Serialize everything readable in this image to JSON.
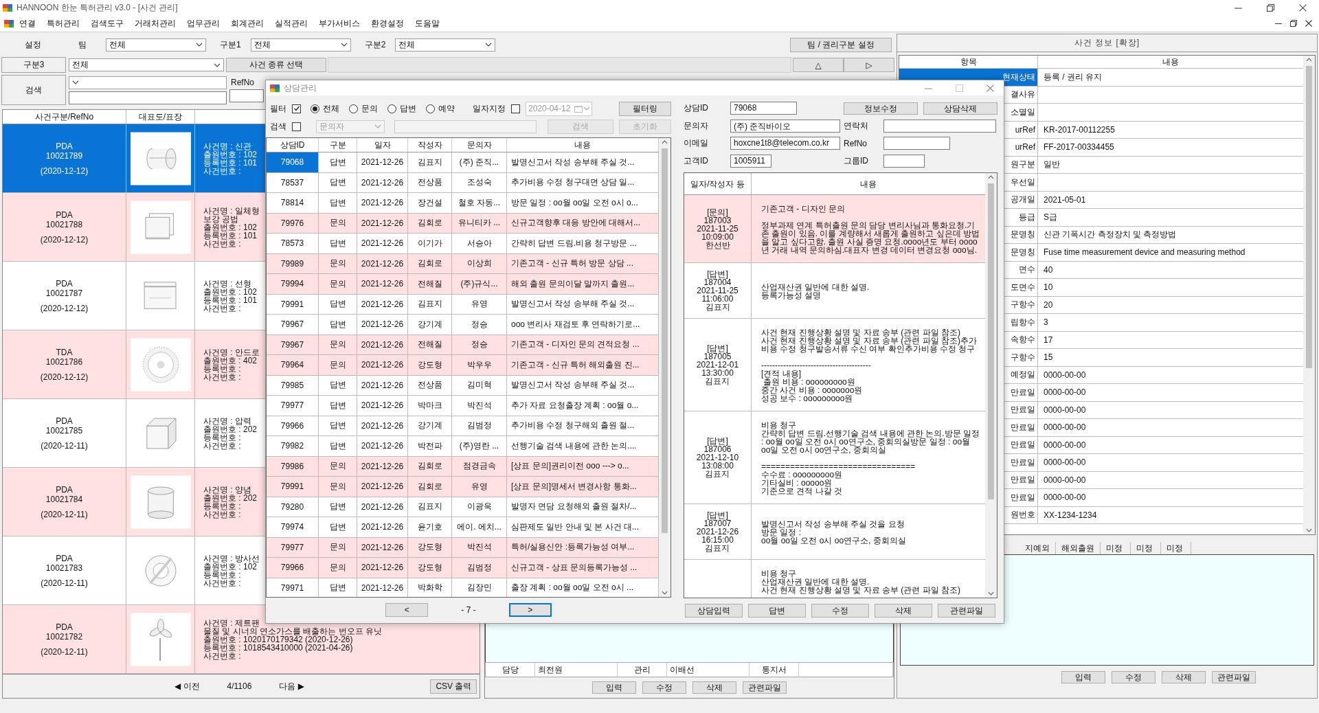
{
  "window": {
    "title": "HANNOON 한눈 특허관리 v3.0 - [사건 관리]"
  },
  "menu": [
    "연결",
    "특허관리",
    "검색도구",
    "거래처관리",
    "업무관리",
    "회계관리",
    "실적관리",
    "부가서비스",
    "환경설정",
    "도움말"
  ],
  "filters": {
    "setting_label": "설정",
    "team_label": "팀",
    "team": "전체",
    "group1_label": "구분1",
    "group1": "전체",
    "group2_label": "구분2",
    "group2": "전체",
    "team_button": "팀 / 권리구분 설정",
    "group3_label": "구분3",
    "group3": "전체",
    "type_button": "사건 종류 선택",
    "up_button": "△",
    "next_button": "▷",
    "search_label": "검색",
    "refno_label": "RefNo"
  },
  "case_list": {
    "columns": [
      "사건구분/RefNo",
      "대표도/표장"
    ],
    "rows": [
      {
        "type": "PDA",
        "ref": "10021789",
        "date": "(2020-12-12)",
        "details": [
          "사건명 : 신관",
          "출원번호 : 102",
          "등록번호 : 101",
          "사건번호 :"
        ],
        "selected": true,
        "highlighted": false
      },
      {
        "type": "PDA",
        "ref": "10021788",
        "date": "(2020-12-12)",
        "details": [
          "사건명 : 일체형",
          "보강 공법",
          "출원번호 : 102",
          "등록번호 : 101",
          "사건번호 :"
        ],
        "selected": false,
        "highlighted": true
      },
      {
        "type": "PDA",
        "ref": "10021787",
        "date": "(2020-12-12)",
        "details": [
          "사건명 : 선형",
          "출원번호 : 102",
          "등록번호 : 101",
          "사건번호 :"
        ],
        "selected": false,
        "highlighted": false
      },
      {
        "type": "TDA",
        "ref": "10021786",
        "date": "(2020-12-12)",
        "details": [
          "사건명 : 안드로",
          "출원번호 : 402",
          "등록번호 :",
          "사건번호 :"
        ],
        "selected": false,
        "highlighted": true
      },
      {
        "type": "PDA",
        "ref": "10021785",
        "date": "(2020-12-11)",
        "details": [
          "사건명 : 압력",
          "출원번호 : 202",
          "등록번호 :",
          "사건번호 :"
        ],
        "selected": false,
        "highlighted": false
      },
      {
        "type": "PDA",
        "ref": "10021784",
        "date": "(2020-12-11)",
        "details": [
          "사건명 : 양념",
          "출원번호 : 202",
          "등록번호 :",
          "사건번호 :"
        ],
        "selected": false,
        "highlighted": true
      },
      {
        "type": "PDA",
        "ref": "10021783",
        "date": "(2020-12-11)",
        "details": [
          "사건명 : 방사선",
          "출원번호 : 102",
          "등록번호 :",
          "사건번호 :"
        ],
        "selected": false,
        "highlighted": false
      },
      {
        "type": "PDA",
        "ref": "10021782",
        "date": "(2020-12-11)",
        "details": [
          "사건명 : 제트팬",
          "물질 및 시너의 연소가스를 배출하는 번오프 유닛",
          "출원번호 : 1020170179342  (2020-12-26)",
          "등록번호 : 1018543410000  (2021-04-26)",
          "사건번호 :"
        ],
        "selected": false,
        "highlighted": true
      }
    ],
    "pager": {
      "prev": "◀ 이전",
      "page": "4/1106",
      "next": "다음 ▶",
      "csv_button": "CSV 출력"
    }
  },
  "case_panel": {
    "fields": [
      {
        "label": "담당",
        "value": "최전원"
      },
      {
        "label": "관리",
        "value": "이배선"
      },
      {
        "label": "통지서"
      }
    ],
    "buttons": [
      "입력",
      "수정",
      "삭제",
      "관련파일"
    ]
  },
  "case_info": {
    "title": "사건 정보 [확장]",
    "columns": [
      "항목",
      "내용"
    ],
    "rows": [
      {
        "label": "현재상태",
        "value": "등록 / 권리 유지",
        "selected": true
      },
      {
        "label": "결사유",
        "selected": false
      },
      {
        "label": "소멸일",
        "selected": false
      },
      {
        "label": "urRef",
        "value": "KR-2017-00112255",
        "selected": false
      },
      {
        "label": "urRef",
        "value": "FF-2017-00334455",
        "selected": false
      },
      {
        "label": "원구분",
        "value": "일반",
        "selected": false
      },
      {
        "label": "우선일",
        "selected": false
      },
      {
        "label": "공개일",
        "value": "2021-05-01",
        "selected": false
      },
      {
        "label": "등급",
        "value": "S급",
        "selected": false
      },
      {
        "label": "문명칭",
        "value": "신관 기폭시간 측정장치 및 측정방법",
        "selected": false
      },
      {
        "label": "문명칭",
        "value": "Fuse time measurement device and measuring method",
        "selected": false
      },
      {
        "label": "면수",
        "value": "40",
        "selected": false
      },
      {
        "label": "도면수",
        "value": "10",
        "selected": false
      },
      {
        "label": "구항수",
        "value": "20",
        "selected": false
      },
      {
        "label": "립항수",
        "value": "3",
        "selected": false
      },
      {
        "label": "속항수",
        "value": "17",
        "selected": false
      },
      {
        "label": "구항수",
        "value": "15",
        "selected": false
      },
      {
        "label": "예정일",
        "value": "0000-00-00",
        "selected": false
      },
      {
        "label": "만료일",
        "value": "0000-00-00",
        "selected": false
      },
      {
        "label": "만료일",
        "value": "0000-00-00",
        "selected": false
      },
      {
        "label": "만료일",
        "value": "0000-00-00",
        "selected": false
      },
      {
        "label": "만료일",
        "value": "0000-00-00",
        "selected": false
      },
      {
        "label": "만료일",
        "value": "0000-00-00",
        "selected": false
      },
      {
        "label": "만료일",
        "value": "0000-00-00",
        "selected": false
      },
      {
        "label": "만료일",
        "value": "0000-00-00",
        "selected": false
      },
      {
        "label": "원번호",
        "value": "XX-1234-1234",
        "selected": false
      }
    ],
    "tabs": [
      {
        "label": "지예외",
        "selected": false
      },
      {
        "label": "해외출원",
        "selected": false
      },
      {
        "label": "미정",
        "selected": false
      },
      {
        "label": "미정",
        "selected": false
      },
      {
        "label": "미정",
        "selected": false
      }
    ],
    "buttons": [
      "입력",
      "수정",
      "삭제",
      "관련파일"
    ]
  },
  "dialog": {
    "title": "상담관리",
    "filter": {
      "filter_label": "필터",
      "filter_checked": true,
      "options": [
        {
          "label": "전체",
          "selected": true
        },
        {
          "label": "문의",
          "selected": false
        },
        {
          "label": "답변",
          "selected": false
        },
        {
          "label": "예약",
          "selected": false
        }
      ],
      "date_label": "일자지정",
      "date_checked": false,
      "date": "2020-04-12",
      "date_disabled": true,
      "filter_button": "필터링",
      "search_label": "검색",
      "search_checked": false,
      "search_field": "문의자",
      "search_disabled": true,
      "search_button": "검색",
      "reset_button": "초기화"
    },
    "table": {
      "columns": [
        "상담ID",
        "구분",
        "일자",
        "작성자",
        "문의자",
        "내용"
      ],
      "rows": [
        {
          "cells": [
            "79068",
            "답변",
            "2021-12-26",
            "김표지",
            "(주) 준직...",
            "발명신고서 작성 송부해 주실 것..."
          ],
          "selected": true,
          "highlighted": false
        },
        {
          "cells": [
            "78537",
            "답변",
            "2021-12-26",
            "전상품",
            "조성숙",
            "추가비용 수정 청구대면 상담 일..."
          ],
          "selected": false,
          "highlighted": false
        },
        {
          "cells": [
            "78814",
            "답변",
            "2021-12-26",
            "장건설",
            "철호 자동...",
            "방문 일정 : oo월 oo일 오전 o시 o..."
          ],
          "selected": false,
          "highlighted": false
        },
        {
          "cells": [
            "79976",
            "문의",
            "2021-12-26",
            "김회로",
            "유니티카 ...",
            "신규고객향후 대응 방안에 대해서..."
          ],
          "selected": false,
          "highlighted": true
        },
        {
          "cells": [
            "78573",
            "답변",
            "2021-12-26",
            "이기가",
            "서승아",
            "간략히 답변 드림.비용 청구방문 ..."
          ],
          "selected": false,
          "highlighted": false
        },
        {
          "cells": [
            "79989",
            "문의",
            "2021-12-26",
            "김회로",
            "이상희",
            "기존고객 - 신규 특허 방문 상담 ..."
          ],
          "selected": false,
          "highlighted": true
        },
        {
          "cells": [
            "79994",
            "문의",
            "2021-12-26",
            "전해질",
            "(주)규식...",
            "해외 출원 문의이달 말까지 출원..."
          ],
          "selected": false,
          "highlighted": true
        },
        {
          "cells": [
            "79991",
            "답변",
            "2021-12-26",
            "김표지",
            "유영",
            "발명신고서 작성 송부해 주실 것..."
          ],
          "selected": false,
          "highlighted": false
        },
        {
          "cells": [
            "79967",
            "답변",
            "2021-12-26",
            "강기계",
            "정승",
            "ooo 변리사 재검토 후 연락하기로..."
          ],
          "selected": false,
          "highlighted": false
        },
        {
          "cells": [
            "79967",
            "문의",
            "2021-12-26",
            "전해질",
            "정승",
            "기존고객 - 디자인 문의 견적요청 ..."
          ],
          "selected": false,
          "highlighted": true
        },
        {
          "cells": [
            "79964",
            "문의",
            "2021-12-26",
            "강도형",
            "박우우",
            "기존고객 - 신규 특허 해외출원 진..."
          ],
          "selected": false,
          "highlighted": true
        },
        {
          "cells": [
            "79985",
            "답변",
            "2021-12-26",
            "전상품",
            "김미혁",
            "발명신고서 작성 송부해 주실 것..."
          ],
          "selected": false,
          "highlighted": false
        },
        {
          "cells": [
            "79977",
            "답변",
            "2021-12-26",
            "박마크",
            "박진석",
            "추가 자료 요청출장 계획 : oo월 o..."
          ],
          "selected": false,
          "highlighted": false
        },
        {
          "cells": [
            "79966",
            "답변",
            "2021-12-26",
            "강기계",
            "김범정",
            "추가비용 수정 청구해외 출원 절..."
          ],
          "selected": false,
          "highlighted": false
        },
        {
          "cells": [
            "79982",
            "답변",
            "2021-12-26",
            "박전파",
            "(주)영란 ...",
            "선행기술 검색 내용에 관한 논의...."
          ],
          "selected": false,
          "highlighted": false
        },
        {
          "cells": [
            "79986",
            "문의",
            "2021-12-26",
            "김회로",
            "점경금속",
            "[상표 문의]권리이전  ooo ---> o..."
          ],
          "selected": false,
          "highlighted": true
        },
        {
          "cells": [
            "79991",
            "문의",
            "2021-12-26",
            "김회로",
            "유영",
            "[상표 문의]명세서 변경사항 통화..."
          ],
          "selected": false,
          "highlighted": true
        },
        {
          "cells": [
            "79280",
            "답변",
            "2021-12-26",
            "김표지",
            "이광욱",
            "발명자 면담 요청해외 출원 절차/..."
          ],
          "selected": false,
          "highlighted": false
        },
        {
          "cells": [
            "79974",
            "답변",
            "2021-12-26",
            "윤기호",
            "에이. 에치...",
            "심판제도 일반 안내 및 본 사건 대..."
          ],
          "selected": false,
          "highlighted": false
        },
        {
          "cells": [
            "79977",
            "문의",
            "2021-12-26",
            "강도형",
            "박진석",
            "특허/실용신안 :등록가능성 여부..."
          ],
          "selected": false,
          "highlighted": true
        },
        {
          "cells": [
            "79966",
            "문의",
            "2021-12-26",
            "강도형",
            "김범정",
            "신규고객 - 상표 문의등록가능성 ..."
          ],
          "selected": false,
          "highlighted": true
        },
        {
          "cells": [
            "79971",
            "답변",
            "2021-12-26",
            "박화학",
            "김장민",
            "출장 계획 : oo월 oo일 오전 o시 ..."
          ],
          "selected": false,
          "highlighted": false
        }
      ]
    },
    "pager": {
      "prev": "<",
      "page": "- 7 -",
      "next": ">"
    },
    "detail": {
      "buttons": [
        "정보수정",
        "상담삭제"
      ],
      "rows": [
        [
          {
            "label": "상담ID",
            "value": "79068"
          }
        ],
        [
          {
            "label": "문의자",
            "value": "(주) 준직바이오"
          },
          {
            "label": "연락처"
          }
        ],
        [
          {
            "label": "이메일",
            "value": "hoxcne1t8@telecom.co.kr"
          },
          {
            "label": "RefNo"
          }
        ],
        [
          {
            "label": "고객ID",
            "value": "1005911"
          },
          {
            "label": "그룹ID"
          }
        ]
      ]
    },
    "history": {
      "columns": [
        "일자/작성자 등",
        "내용"
      ],
      "entries": [
        {
          "tag": "[문의]",
          "id": "187003",
          "date": "2021-11-25",
          "time": "10:09:00",
          "author": "한선반",
          "text": "기존고객 - 디자인 문의\n\n정부과제 연계 특허출원 문의 담당 변리사님과 통화요청.기존 출원이 있음. 이를 계량해서 새롭게 출원하고 싶은데 방법을 알고 싶다고함. 출원 사실 증명 요청.oooo년도 부터 oooo년 거래 내역 문의하심.대표자 변경 데이터 변경요청 ooo님.",
          "highlighted": true
        },
        {
          "tag": "[답변]",
          "id": "187004",
          "date": "2021-11-25",
          "time": "11:06:00",
          "author": "김표지",
          "text": "산업재산권 일반에 대한 설명.\n등록가능성 설명",
          "highlighted": false
        },
        {
          "tag": "[답변]",
          "id": "187005",
          "date": "2021-12-01",
          "time": "13:30:00",
          "author": "김표지",
          "text": "사건 현재 진행상황 설명 및 자료 송부 (관련 파일 참조)\n사건 현재 진행상황 설명 및 자료 송부 (관련 파일 참조)추가비용 수정 청구발송서류 수신 여부 확인추가비용 수정 청구\n\n----------------------------------------\n[견적 내용]\n 출원 비용 : ooooooooo원\n중간 사건 비용 : ooooooo원\n성공 보수 : ooooooooo원",
          "highlighted": false
        },
        {
          "tag": "[답변]",
          "id": "187006",
          "date": "2021-12-10",
          "time": "13:08:00",
          "author": "김표지",
          "text": "비용 청구\n간략히 답변 드림.선행기술 검색 내용에 관한 논의.방문 일정 : oo월 oo일 오전 o시 oo연구소, 중회의실방문 일정 : oo월 oo일 오전 o시 oo연구소, 중회의실\n\n================================\n수수료 : ooooooooo원\n기타실비 : ooooo원\n기준으로 견적 나갈 것",
          "highlighted": false
        },
        {
          "tag": "[답변]",
          "id": "187007",
          "date": "2021-12-26",
          "time": "16:15:00",
          "author": "김표지",
          "text": "발명신고서 작성 송부해 주실 것을 요청\n방문 일정 :\noo월 oo일 오전 o시 oo연구소, 중회의실",
          "highlighted": false
        }
      ],
      "partial_text": "비용 청구\n산업재산권 일반에 대한 설명.\n사건 현재 진행상황 설명 및 자료 송부 (관련 파일 참조)"
    },
    "buttons": [
      "상담입력",
      "답변",
      "수정",
      "삭제",
      "관련파일"
    ]
  }
}
